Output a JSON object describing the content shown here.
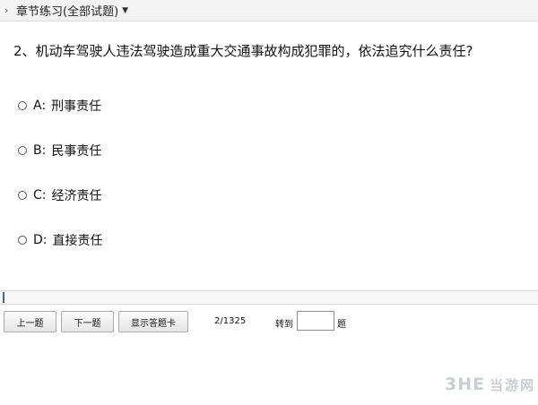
{
  "header": {
    "title": "章节练习(全部试题)",
    "chevron_icon": "chevron-right-icon",
    "dropdown_icon": "caret-down-icon"
  },
  "question": {
    "text": "2、机动车驾驶人违法驾驶造成重大交通事故构成犯罪的，依法追究什么责任?"
  },
  "options": [
    {
      "letter": "A:",
      "text": "刑事责任"
    },
    {
      "letter": "B:",
      "text": "民事责任"
    },
    {
      "letter": "C:",
      "text": "经济责任"
    },
    {
      "letter": "D:",
      "text": "直接责任"
    }
  ],
  "toolbar": {
    "prev_label": "上一题",
    "next_label": "下一题",
    "show_card_label": "显示答题卡",
    "page_count": "2/1325",
    "goto_label": "转到",
    "goto_value": "",
    "ti_label": "题"
  },
  "watermark": {
    "logo": "3HE",
    "text": "当游网"
  },
  "colors": {
    "header_bg": "#f3f3f3",
    "accent": "#3a6f8a",
    "watermark": "#c8cdd2"
  }
}
